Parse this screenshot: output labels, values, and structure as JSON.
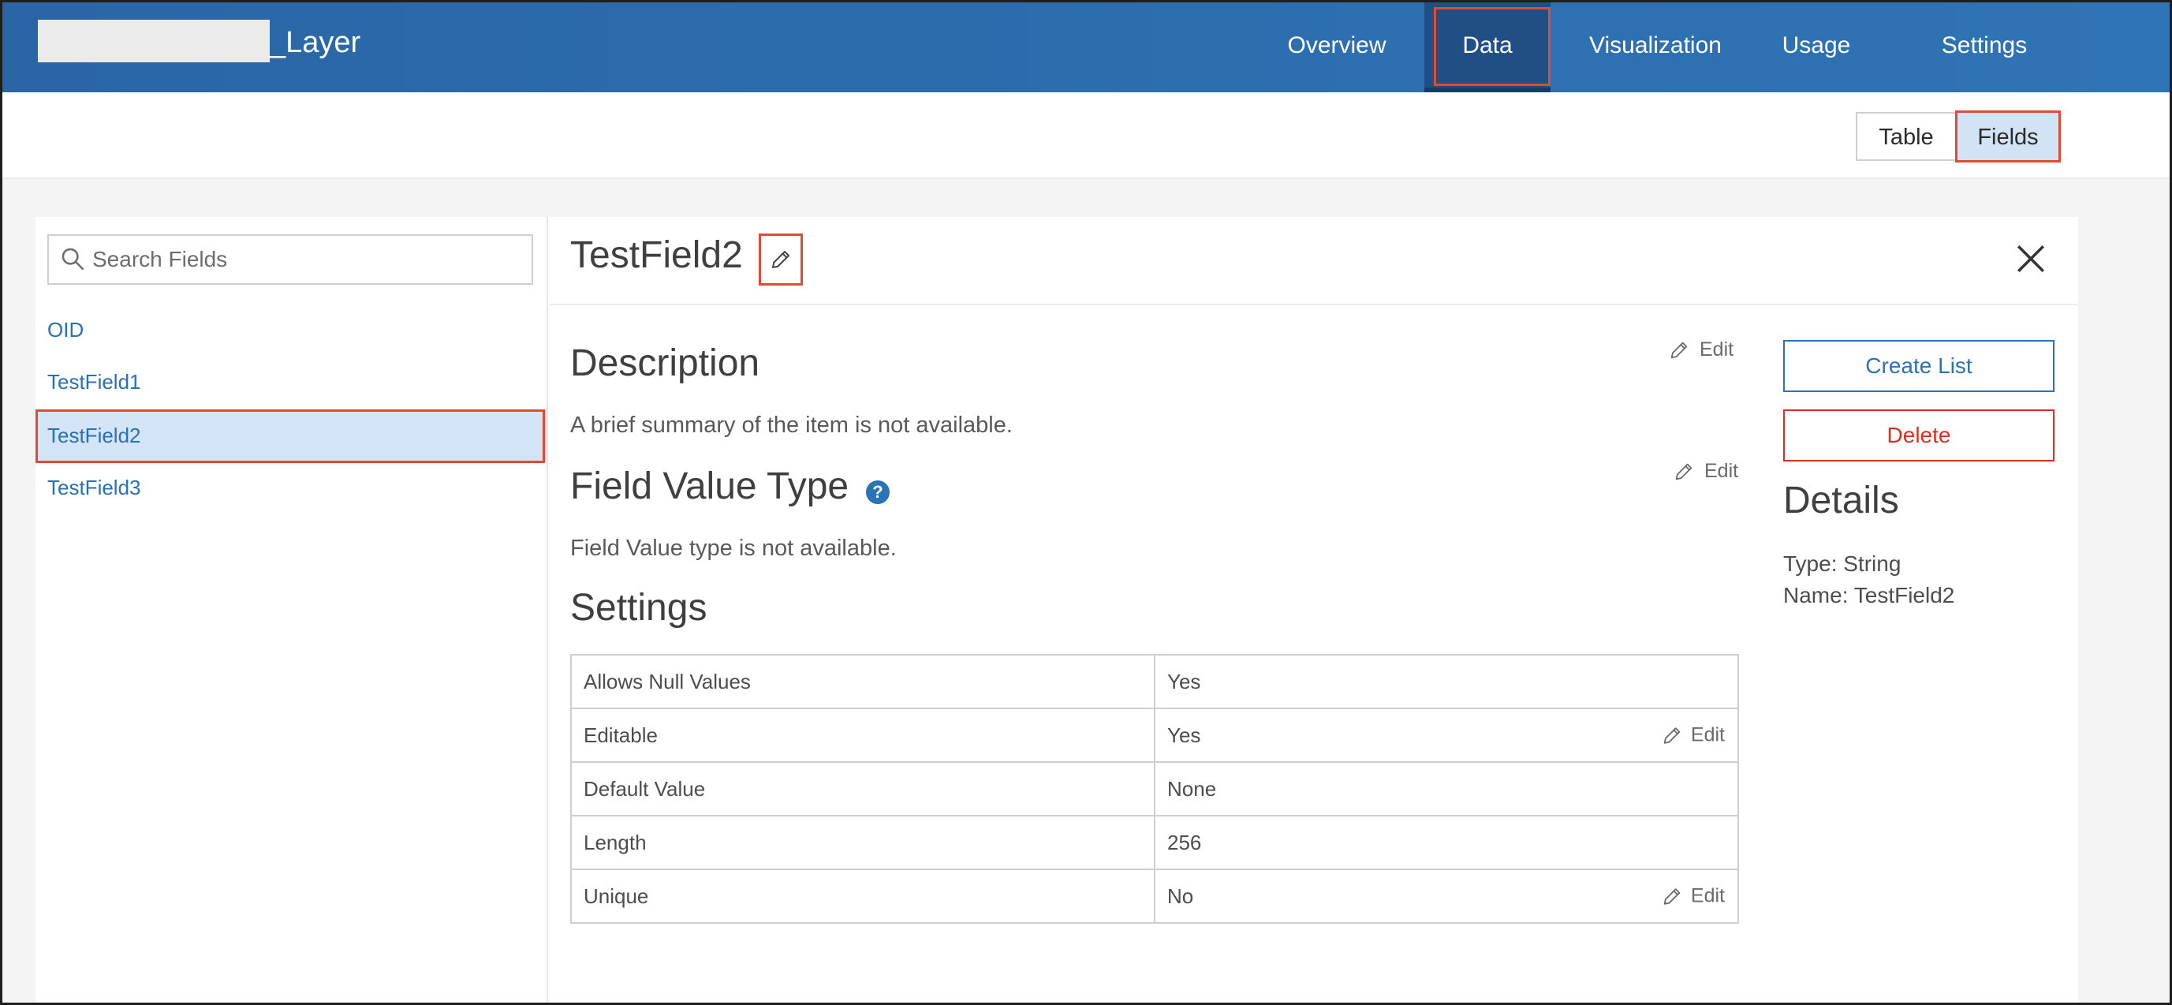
{
  "app": {
    "title_suffix": "_Layer"
  },
  "nav": {
    "tabs": [
      {
        "label": "Overview"
      },
      {
        "label": "Data",
        "active": true
      },
      {
        "label": "Visualization"
      },
      {
        "label": "Usage"
      },
      {
        "label": "Settings"
      }
    ]
  },
  "view_toggle": {
    "table_label": "Table",
    "fields_label": "Fields",
    "selected": "Fields"
  },
  "search": {
    "placeholder": "Search Fields",
    "value": ""
  },
  "field_list": {
    "items": [
      {
        "label": "OID"
      },
      {
        "label": "TestField1"
      },
      {
        "label": "TestField2",
        "selected": true
      },
      {
        "label": "TestField3"
      }
    ]
  },
  "detail": {
    "title": "TestField2",
    "description": {
      "heading": "Description",
      "text": "A brief summary of the item is not available.",
      "edit_label": "Edit"
    },
    "value_type": {
      "heading": "Field Value Type",
      "text": "Field Value type is not available.",
      "edit_label": "Edit",
      "help_glyph": "?"
    },
    "settings": {
      "heading": "Settings",
      "rows": [
        {
          "label": "Allows Null Values",
          "value": "Yes"
        },
        {
          "label": "Editable",
          "value": "Yes",
          "edit_label": "Edit"
        },
        {
          "label": "Default Value",
          "value": "None"
        },
        {
          "label": "Length",
          "value": "256"
        },
        {
          "label": "Unique",
          "value": "No",
          "edit_label": "Edit"
        }
      ]
    }
  },
  "side": {
    "create_list_label": "Create List",
    "delete_label": "Delete",
    "details_heading": "Details",
    "type_line": "Type: String",
    "name_line": "Name: TestField2"
  },
  "colors": {
    "header_blue": "#2f74b6",
    "active_tab": "#1f4f85",
    "highlight_red": "#e24a33",
    "link_blue": "#2970b4",
    "selected_bg": "#d2e4f6",
    "delete_red": "#d83020"
  },
  "icons": {
    "search": "search-icon",
    "pencil": "pencil-icon",
    "close": "close-icon",
    "help": "help-icon"
  }
}
